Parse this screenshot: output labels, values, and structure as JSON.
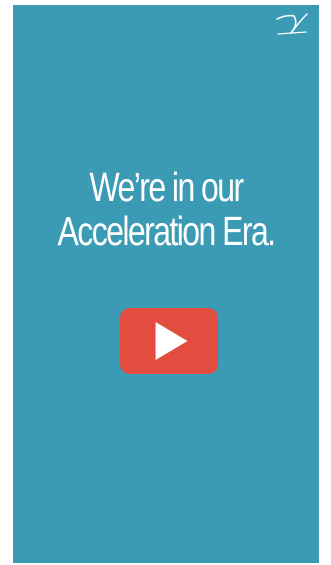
{
  "video": {
    "headline_line1": "We’re in our",
    "headline_line2": "Acceleration Era.",
    "background_color": "#3b9bb4",
    "text_color": "#ffffff"
  },
  "play_button": {
    "icon": "play-icon",
    "color": "#e24d3f"
  },
  "logo": {
    "icon": "signature-logo-icon"
  }
}
